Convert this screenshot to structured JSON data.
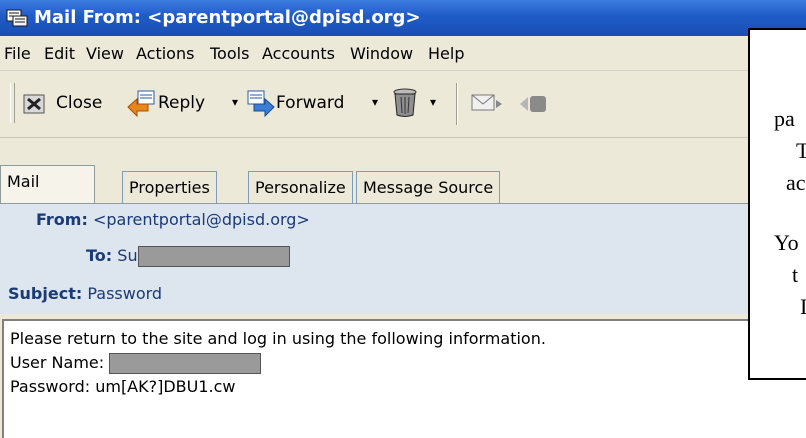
{
  "window": {
    "title": "Mail From: <parentportal@dpisd.org>"
  },
  "menu": [
    "File",
    "Edit",
    "View",
    "Actions",
    "Tools",
    "Accounts",
    "Window",
    "Help"
  ],
  "toolbar": {
    "close_label": "Close",
    "reply_label": "Reply",
    "forward_label": "Forward",
    "dropdown_arrow": "▾"
  },
  "tabs": [
    "Mail",
    "Properties",
    "Personalize",
    "Message Source"
  ],
  "header": {
    "from_label": "From:",
    "from_value": "<parentportal@dpisd.org>",
    "to_label": "To:",
    "to_value": "Su",
    "subject_label": "Subject:",
    "subject_value": "Password"
  },
  "body": {
    "line1": "Please return to the site and log in using the following information.",
    "line2_label": "User Name:",
    "line3": "Password: um[AK?]DBU1.cw"
  },
  "callout": {
    "lines": [
      "pa",
      "T",
      "ac",
      "Yo",
      "t",
      "I"
    ]
  }
}
